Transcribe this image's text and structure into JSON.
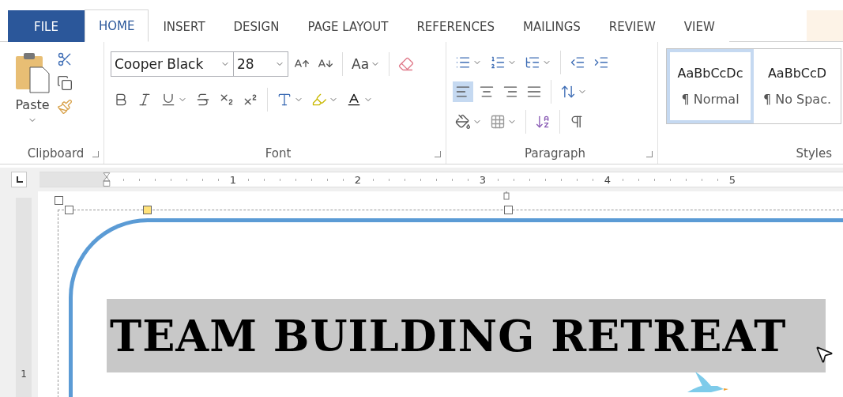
{
  "tabs": [
    {
      "label": "FILE",
      "kind": "file",
      "selected": false
    },
    {
      "label": "HOME",
      "kind": "tab",
      "selected": true
    },
    {
      "label": "INSERT",
      "kind": "tab",
      "selected": false
    },
    {
      "label": "DESIGN",
      "kind": "tab",
      "selected": false
    },
    {
      "label": "PAGE LAYOUT",
      "kind": "tab",
      "selected": false
    },
    {
      "label": "REFERENCES",
      "kind": "tab",
      "selected": false
    },
    {
      "label": "MAILINGS",
      "kind": "tab",
      "selected": false
    },
    {
      "label": "REVIEW",
      "kind": "tab",
      "selected": false
    },
    {
      "label": "VIEW",
      "kind": "tab",
      "selected": false
    }
  ],
  "clipboard": {
    "paste_label": "Paste",
    "group_label": "Clipboard"
  },
  "font": {
    "name": "Cooper Black",
    "size": "28",
    "change_case": "Aa",
    "group_label": "Font"
  },
  "paragraph": {
    "alignments": [
      {
        "kind": "left",
        "selected": true
      },
      {
        "kind": "center",
        "selected": false
      },
      {
        "kind": "right",
        "selected": false
      },
      {
        "kind": "justify",
        "selected": false
      }
    ],
    "group_label": "Paragraph"
  },
  "styles": {
    "items": [
      {
        "preview": "AaBbCcDc",
        "name": "¶ Normal",
        "selected": true
      },
      {
        "preview": "AaBbCcD",
        "name": "¶ No Spac.",
        "selected": false
      }
    ],
    "group_label": "Styles"
  },
  "ruler": {
    "numbers": [
      "1",
      "2",
      "3",
      "4",
      "5"
    ]
  },
  "vertical_ruler": {
    "numbers": [
      "1"
    ]
  },
  "document": {
    "heading": "TEAM BUILDING RETREAT"
  }
}
